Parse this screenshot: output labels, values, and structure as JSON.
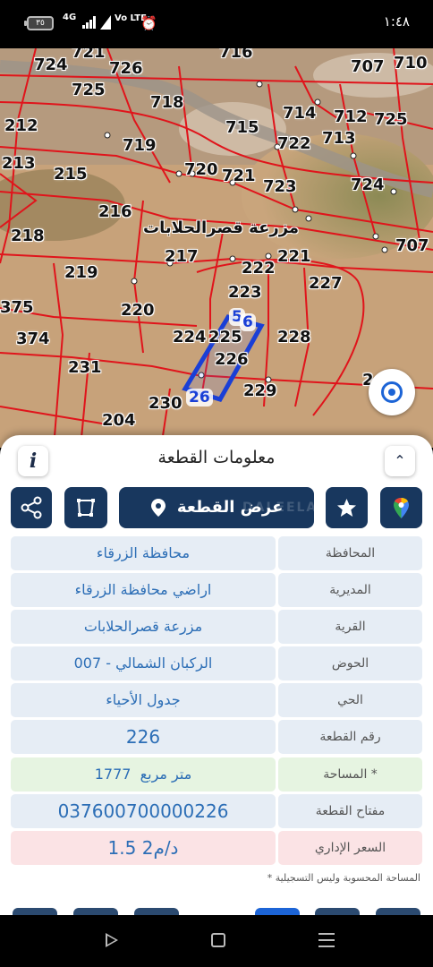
{
  "status_bar": {
    "time": "١:٤٨",
    "battery": "٣٥",
    "network": "4G",
    "volte": "Vo LTE"
  },
  "map": {
    "village_label": "مزرعة قصرالحلابات",
    "plots": [
      "724",
      "721",
      "726",
      "716",
      "707",
      "710",
      "725",
      "718",
      "212",
      "715",
      "714",
      "712",
      "725",
      "719",
      "722",
      "713",
      "213",
      "215",
      "720",
      "721",
      "723",
      "724",
      "216",
      "218",
      "217",
      "221",
      "707",
      "219",
      "222",
      "227",
      "375",
      "220",
      "223",
      "5",
      "6",
      "374",
      "224",
      "225",
      "228",
      "231",
      "226",
      "229",
      "2",
      "230",
      "26",
      "204"
    ],
    "highlight_labels": [
      "5",
      "6",
      "26"
    ],
    "highlight_color": "#1a3fd6",
    "boundary_color": "#e0141b",
    "locate_icon": "locate-icon"
  },
  "panel": {
    "title": "معلومات القطعة",
    "info_icon": "i",
    "collapse_icon": "⌃",
    "view_plot_label": "عرض القطعة",
    "watermark": "DALEELAQAR",
    "rows": [
      {
        "label": "المحافظة",
        "value": "محافظة الزرقاء"
      },
      {
        "label": "المديرية",
        "value": "اراضي محافظة الزرقاء"
      },
      {
        "label": "القرية",
        "value": "مزرعة قصرالحلابات"
      },
      {
        "label": "الحوض",
        "value": "الركبان الشمالي - 007"
      },
      {
        "label": "الحي",
        "value": "جدول الأحياء"
      },
      {
        "label": "رقم القطعة",
        "value": "226"
      },
      {
        "label": "المساحة *",
        "value": "1777  متر مربع"
      },
      {
        "label": "مفتاح القطعة",
        "value": "037600700000226"
      },
      {
        "label": "السعر الإداري",
        "value": "1.5 د/م2"
      }
    ],
    "footnote": "* المساحة المحسوبة وليس التسجيلية"
  },
  "colors": {
    "primary": "#18375e",
    "link": "#2c6eb6",
    "area_bg": "#e6f4e1",
    "price_bg": "#fbe3e5"
  }
}
